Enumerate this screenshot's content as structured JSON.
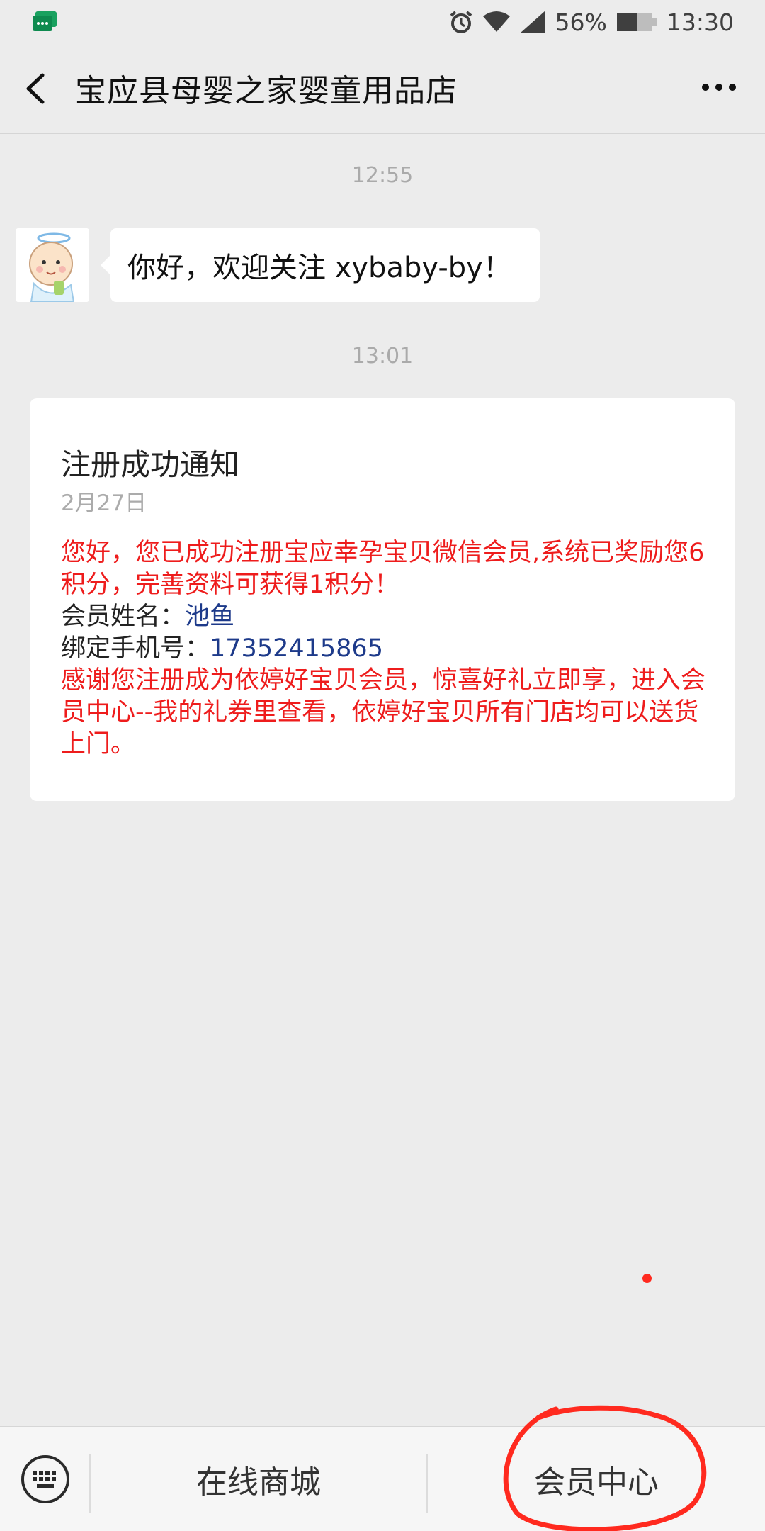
{
  "status_bar": {
    "battery": "56%",
    "time": "13:30",
    "icons": [
      "wechat-notification-icon",
      "alarm-icon",
      "wifi-icon",
      "signal-icon",
      "battery-icon"
    ]
  },
  "nav": {
    "title": "宝应县母婴之家婴童用品店",
    "back_icon": "chevron-left-icon",
    "more_icon": "more-dots-icon"
  },
  "chat": {
    "timestamp_1": "12:55",
    "welcome_text": "你好，欢迎关注 xybaby-by！",
    "timestamp_2": "13:01",
    "card": {
      "title": "注册成功通知",
      "date": "2月27日",
      "line_intro": "您好，您已成功注册宝应幸孕宝贝微信会员,系统已奖励您6积分，完善资料可获得1积分！",
      "member_name_label": "会员姓名：",
      "member_name_value": "池鱼",
      "phone_label": "绑定手机号：",
      "phone_value": "17352415865",
      "line_outro": "感谢您注册成为依婷好宝贝会员，惊喜好礼立即享，进入会员中心--我的礼券里查看，依婷好宝贝所有门店均可以送货上门。"
    }
  },
  "bottom_menu": {
    "keyboard_icon": "keyboard-icon",
    "items": [
      {
        "label": "在线商城"
      },
      {
        "label": "会员中心"
      }
    ]
  },
  "colors": {
    "background": "#ececec",
    "highlight_red": "#ee1c1c",
    "value_blue": "#1d3a8a",
    "annotation_red": "#ff2a1f"
  }
}
